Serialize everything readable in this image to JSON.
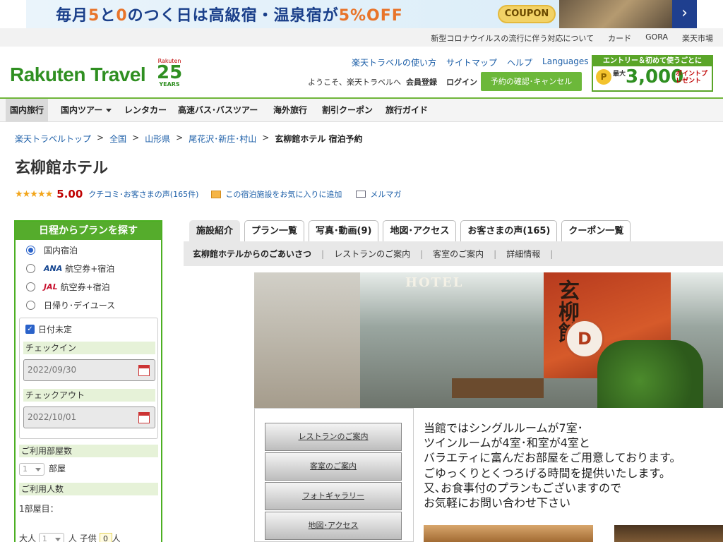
{
  "banner": {
    "text_a": "毎月",
    "text_b": "5",
    "text_c": "と",
    "text_d": "0",
    "text_e": "のつく日は",
    "text_f": "高級宿・温泉宿",
    "text_g": "が",
    "text_h": "5%OFF",
    "coupon": "COUPON",
    "next": "›"
  },
  "utility": {
    "items": [
      "新型コロナウイルスの流行に伴う対応について",
      "カード",
      "GORA",
      "楽天市場"
    ]
  },
  "header": {
    "logo": "Rakuten Travel",
    "years_small": "Rakuten",
    "years_num": "25",
    "years_label": "YEARS",
    "links": [
      "楽天トラベルの使い方",
      "サイトマップ",
      "ヘルプ",
      "Languages"
    ],
    "welcome": "ようこそ、楽天トラベルへ",
    "member": "会員登録",
    "login": "ログイン",
    "reserve": "予約の確認･キャンセル",
    "promo_top": "エントリー＆初めて使うごとに",
    "promo_coin": "P",
    "promo_max": "最大",
    "promo_num": "3,000",
    "promo_pt": "ポイントプレゼント"
  },
  "nav": {
    "items": [
      "国内旅行",
      "国内ツアー",
      "レンタカー",
      "高速バス･バスツアー",
      "海外旅行",
      "割引クーポン",
      "旅行ガイド"
    ]
  },
  "breadcrumb": {
    "items": [
      "楽天トラベルトップ",
      "全国",
      "山形県",
      "尾花沢･新庄･村山"
    ],
    "current": "玄柳館ホテル 宿泊予約",
    "sep": ">"
  },
  "hotel": {
    "name": "玄柳館ホテル",
    "stars": "★★★★★",
    "score": "5.00",
    "reviews": "クチコミ･お客さまの声(165件)",
    "favorite": "この宿泊施設をお気に入りに追加",
    "mailmag": "メルマガ"
  },
  "sidebar": {
    "title": "日程からプランを探す",
    "options": [
      "国内宿泊",
      "航空券+宿泊",
      "航空券+宿泊",
      "日帰り･デイユース"
    ],
    "ana": "ANA",
    "jal": "JAL",
    "date_undecided": "日付未定",
    "checkin_label": "チェックイン",
    "checkin_value": "2022/09/30",
    "checkout_label": "チェックアウト",
    "checkout_value": "2022/10/01",
    "rooms_label": "ご利用部屋数",
    "rooms_value": "1",
    "rooms_unit": "部屋",
    "people_label": "ご利用人数",
    "room1": "1部屋目：",
    "adult": "大人",
    "adult_value": "1",
    "person_unit": "人",
    "child": "子供",
    "child_value": "0"
  },
  "tabs": {
    "items": [
      "施設紹介",
      "プラン一覧",
      "写真･動画(9)",
      "地図･アクセス",
      "お客さまの声(165)",
      "クーポン一覧"
    ]
  },
  "subnav": {
    "items": [
      "玄柳館ホテルからのごあいさつ",
      "レストランのご案内",
      "客室のご案内",
      "詳細情報"
    ]
  },
  "hero": {
    "hotel_sign": "HOTEL",
    "kanji_sign": "玄柳館",
    "bar_mark": "D"
  },
  "menu": {
    "items": [
      "レストランのご案内",
      "客室のご案内",
      "フォトギャラリー",
      "地図･アクセス"
    ]
  },
  "greeting": {
    "lines": [
      "当館ではシングルルームが7室･",
      "ツインルームが4室･和室が4室と",
      "バラエティに富んだお部屋をご用意しております。",
      "ごゆっくりとくつろげる時間を提供いたします。",
      "又､お食事付のプランもございますので",
      "お気軽にお問い合わせ下さい"
    ]
  }
}
